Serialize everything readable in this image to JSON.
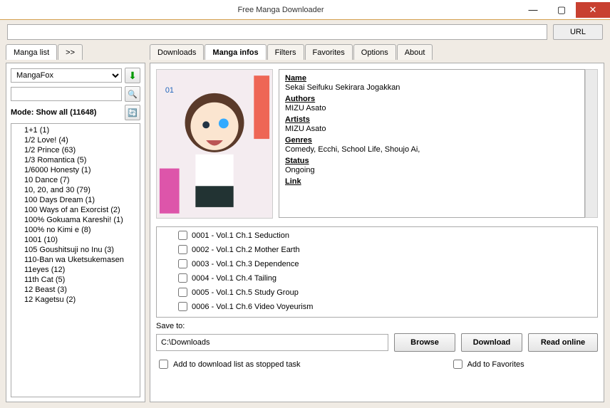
{
  "window": {
    "title": "Free Manga Downloader"
  },
  "urlbar": {
    "value": "",
    "button": "URL"
  },
  "left": {
    "tabs": [
      "Manga list",
      ">>"
    ],
    "source": "MangaFox",
    "search": "",
    "mode": "Mode: Show all (11648)",
    "items": [
      "1+1 (1)",
      "1/2 Love! (4)",
      "1/2 Prince (63)",
      "1/3 Romantica (5)",
      "1/6000 Honesty (1)",
      "10 Dance (7)",
      "10, 20, and 30 (79)",
      "100 Days Dream (1)",
      "100 Ways of an Exorcist (2)",
      "100% Gokuama Kareshi! (1)",
      "100% no Kimi e (8)",
      "1001 (10)",
      "105 Goushitsuji no Inu (3)",
      "110-Ban wa Uketsukemasen",
      "11eyes (12)",
      "11th Cat (5)",
      "12 Beast (3)",
      "12 Kagetsu (2)"
    ]
  },
  "right": {
    "tabs": [
      "Downloads",
      "Manga infos",
      "Filters",
      "Favorites",
      "Options",
      "About"
    ],
    "active_tab": 1,
    "info": {
      "name_h": "Name",
      "name": "Sekai Seifuku Sekirara Jogakkan",
      "authors_h": "Authors",
      "authors": "MIZU Asato",
      "artists_h": "Artists",
      "artists": "MIZU Asato",
      "genres_h": "Genres",
      "genres": "Comedy, Ecchi, School Life, Shoujo Ai,",
      "status_h": "Status",
      "status": "Ongoing",
      "link_h": "Link"
    },
    "chapters": [
      "0001 - Vol.1 Ch.1 Seduction",
      "0002 - Vol.1 Ch.2 Mother Earth",
      "0003 - Vol.1 Ch.3 Dependence",
      "0004 - Vol.1 Ch.4 Tailing",
      "0005 - Vol.1 Ch.5 Study Group",
      "0006 - Vol.1 Ch.6 Video Voyeurism"
    ],
    "save_label": "Save to:",
    "save_path": "C:\\Downloads",
    "browse": "Browse",
    "download": "Download",
    "read": "Read online",
    "chk1": "Add to download list as stopped task",
    "chk2": "Add to Favorites"
  }
}
